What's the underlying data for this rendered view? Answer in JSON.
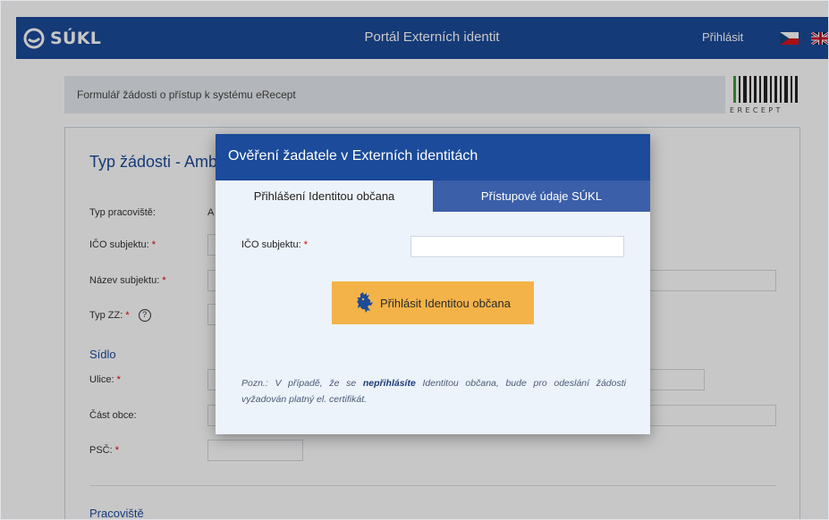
{
  "topbar": {
    "logo_text": "SÚKL",
    "portal_title": "Portál Externích identit",
    "login_label": "Přihlásit",
    "flags": [
      "cz-flag-icon",
      "uk-flag-icon"
    ],
    "color": "#1b4b9a"
  },
  "form_header": {
    "title": "Formulář žádosti o přístup k systému eRecept",
    "erecept_label": "ERECEPT"
  },
  "card": {
    "title": "Typ žádosti - Amb",
    "fields": [
      {
        "label": "Typ pracoviště:",
        "required": false,
        "value": "A"
      },
      {
        "label": "IČO subjektu:",
        "required": true
      },
      {
        "label": "Název subjektu:",
        "required": true
      },
      {
        "label": "Typ ZZ:",
        "required": true,
        "help_icon": "question-circle-icon"
      }
    ],
    "section_sidlo": "Sídlo",
    "address_fields": [
      {
        "label": "Ulice:",
        "required": true
      },
      {
        "label": "Část obce:",
        "required": false
      },
      {
        "label": "PSČ:",
        "required": true
      }
    ],
    "section_pracoviste": "Pracoviště"
  },
  "modal": {
    "title": "Ověření žadatele v Externích identitách",
    "tabs": [
      {
        "label": "Přihlášení Identitou občana",
        "active": true
      },
      {
        "label": "Přístupové údaje SÚKL",
        "active": false
      }
    ],
    "ico_label": "IČO subjektu:",
    "ico_value": "",
    "button_label": "Přihlásit Identitou občana",
    "button_icon": "czech-lion-icon",
    "note_prefix": "Pozn.: V případě, že se ",
    "note_bold": "nepřihlásíte",
    "note_suffix": " Identitou občana, bude pro odeslání žádosti vyžadován platný el. certifikát.",
    "accent_color": "#f3b348"
  },
  "required_marker": "*"
}
